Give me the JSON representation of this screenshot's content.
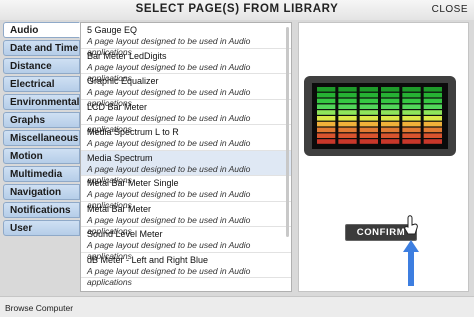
{
  "window": {
    "title": "SELECT PAGE(S) FROM LIBRARY",
    "close_label": "CLOSE"
  },
  "tabs": [
    {
      "label": "Audio",
      "active": true
    },
    {
      "label": "Date and Time",
      "active": false
    },
    {
      "label": "Distance",
      "active": false
    },
    {
      "label": "Electrical",
      "active": false
    },
    {
      "label": "Environmental",
      "active": false
    },
    {
      "label": "Graphs",
      "active": false
    },
    {
      "label": "Miscellaneous",
      "active": false
    },
    {
      "label": "Motion",
      "active": false
    },
    {
      "label": "Multimedia",
      "active": false
    },
    {
      "label": "Navigation",
      "active": false
    },
    {
      "label": "Notifications",
      "active": false
    },
    {
      "label": "User",
      "active": false
    }
  ],
  "library_items": [
    {
      "name": "5 Gauge EQ",
      "description": "A page layout designed to be used in Audio applications"
    },
    {
      "name": "Bar Meter LedDigits",
      "description": "A page layout designed to be used in Audio applications"
    },
    {
      "name": "Graphic Equalizer",
      "description": "A page layout designed to be used in Audio applications"
    },
    {
      "name": "LCD Bar Meter",
      "description": "A page layout designed to be used in Audio applications"
    },
    {
      "name": "Media Spectrum L to R",
      "description": "A page layout designed to be used in Audio applications"
    },
    {
      "name": "Media Spectrum",
      "description": "A page layout designed to be used in Audio applications",
      "selected": true
    },
    {
      "name": "Metal Bar Meter Single",
      "description": "A page layout designed to be used in Audio applications"
    },
    {
      "name": "Metal Bar Meter",
      "description": "A page layout designed to be used in Audio applications"
    },
    {
      "name": "Sound Level Meter",
      "description": "A page layout designed to be used in Audio applications"
    },
    {
      "name": "dB Meter - Left and Right Blue",
      "description": "A page layout designed to be used in Audio applications"
    }
  ],
  "preview": {
    "columns": 6,
    "segment_colors": [
      "#1e9b2a",
      "#26b233",
      "#36c742",
      "#52d65a",
      "#8ee55a",
      "#d9e84a",
      "#f0b13a",
      "#e07a33",
      "#d8542e",
      "#c9372a"
    ],
    "frame_color": "#3f3f3f"
  },
  "confirm_label": "CONFIRM",
  "accent_arrow_color": "#3d7ee0",
  "status": {
    "browse_label": "Browse Computer"
  }
}
